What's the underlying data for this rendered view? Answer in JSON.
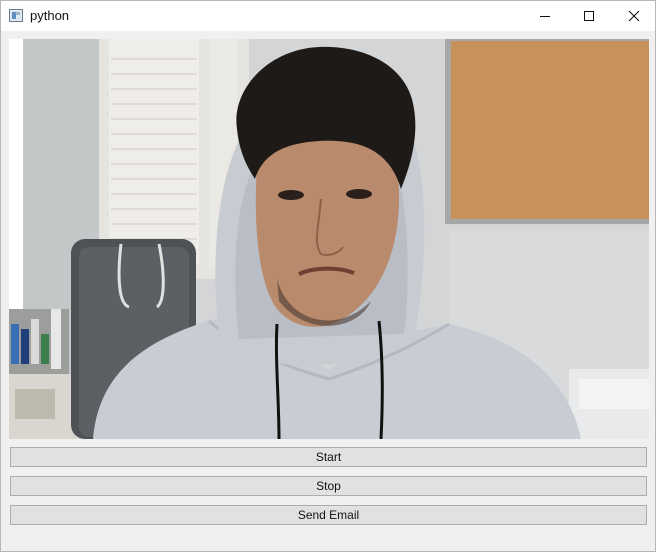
{
  "window": {
    "title": "python",
    "controls": {
      "minimize_icon": "minimize-icon",
      "maximize_icon": "maximize-icon",
      "close_icon": "close-icon"
    }
  },
  "video": {
    "description_icon": "webcam-feed"
  },
  "buttons": {
    "start_label": "Start",
    "stop_label": "Stop",
    "send_email_label": "Send Email"
  },
  "colors": {
    "window_bg": "#f0f0f0",
    "button_bg": "#e1e1e1",
    "button_border": "#adadad",
    "titlebar_bg": "#ffffff"
  }
}
